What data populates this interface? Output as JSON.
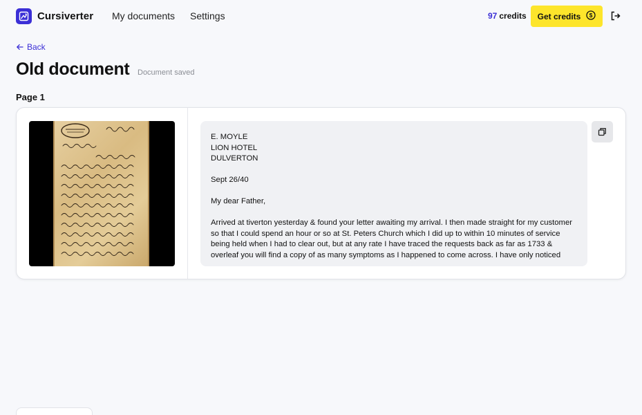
{
  "header": {
    "brand": "Cursiverter",
    "nav": {
      "my_documents": "My documents",
      "settings": "Settings"
    },
    "credits_count": "97",
    "credits_label": "credits",
    "get_credits_label": "Get credits"
  },
  "page": {
    "back_label": "Back",
    "title": "Old document",
    "save_status": "Document saved",
    "page_label": "Page 1"
  },
  "transcription": {
    "lines": [
      "E. MOYLE",
      "LION HOTEL",
      "DULVERTON",
      "",
      "Sept 26/40",
      "",
      "My dear Father,",
      ""
    ],
    "line_1": "E. MOYLE",
    "line_2": "LION HOTEL",
    "line_3": "DULVERTON",
    "date": "Sept 26/40",
    "salutation": "My dear Father,",
    "body": "Arrived at tiverton yesterday & found your letter awaiting my arrival. I then made straight for my customer so that I could spend an hour or so at St. Peters Church which I did up to within 10 minutes of service being held when I had to clear out, but at any rate I have traced the requests back as far as 1733 & overleaf you will find a copy of as many symptoms as I happened to come across. I have only noticed"
  },
  "colors": {
    "accent": "#3b2fd6",
    "cta": "#fde52b",
    "background": "#f7f8fb"
  },
  "icons": {
    "logo": "cursiverter-logo-icon",
    "coin": "coin-icon",
    "logout": "logout-icon",
    "back": "arrow-left-icon",
    "copy": "copy-icon"
  }
}
